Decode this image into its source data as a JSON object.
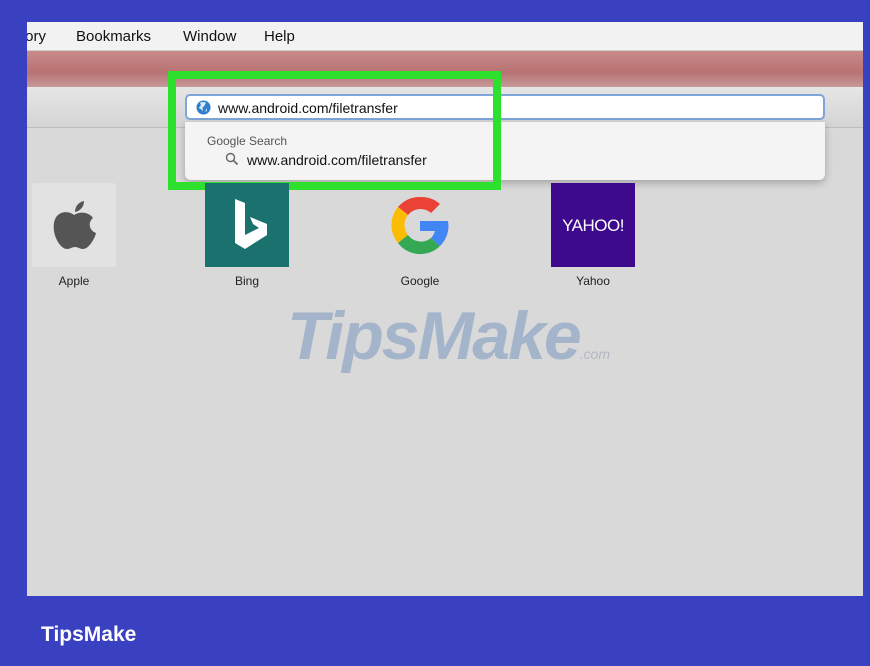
{
  "menubar": {
    "items": [
      "tory",
      "Bookmarks",
      "Window",
      "Help"
    ]
  },
  "address_bar": {
    "url": "www.android.com/filetransfer",
    "icon": "globe-icon"
  },
  "suggestions": {
    "header": "Google Search",
    "items": [
      {
        "text": "www.android.com/filetransfer",
        "icon": "magnifier-icon"
      }
    ]
  },
  "favorites": [
    {
      "label": "Apple",
      "icon": "apple-logo-icon"
    },
    {
      "label": "Bing",
      "icon": "bing-logo-icon"
    },
    {
      "label": "Google",
      "icon": "google-logo-icon"
    },
    {
      "label": "Yahoo",
      "icon": "yahoo-logo-icon",
      "tile_text": "YAHOO!"
    }
  ],
  "watermark": {
    "text": "TipsMake",
    "suffix": ".com"
  },
  "caption": "TipsMake",
  "colors": {
    "frame": "#3a41c0",
    "highlight": "#2ee02e",
    "bing": "#1a716e",
    "yahoo": "#3d0a8e"
  }
}
